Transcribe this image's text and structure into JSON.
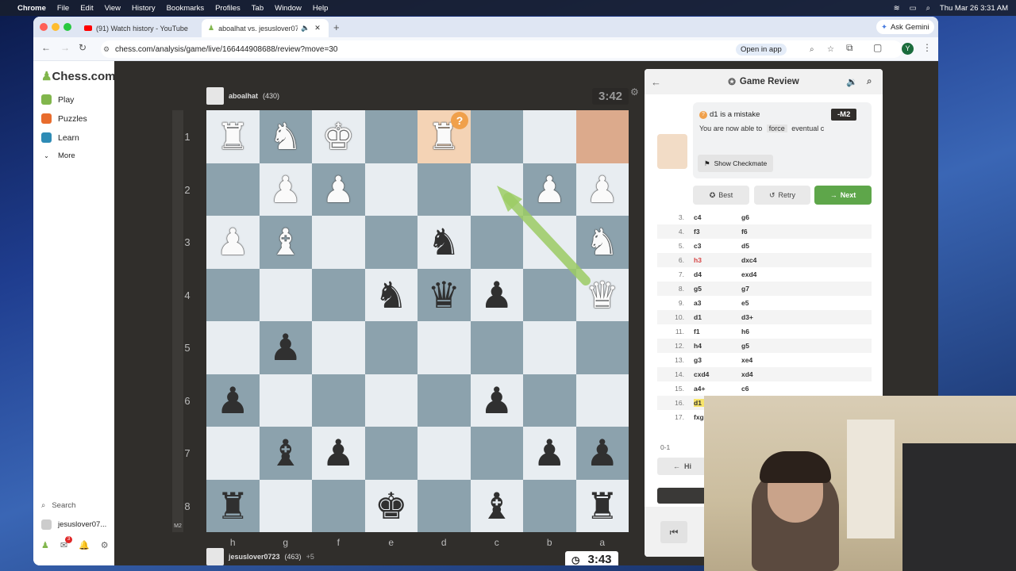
{
  "menubar": {
    "app": "Chrome",
    "items": [
      "File",
      "Edit",
      "View",
      "History",
      "Bookmarks",
      "Profiles",
      "Tab",
      "Window",
      "Help"
    ],
    "datetime": "Thu Mar 26  3:31 AM"
  },
  "tabs": [
    {
      "title": "(91) Watch history - YouTube"
    },
    {
      "title": "aboalhat vs. jesuslover07..."
    }
  ],
  "ask_gemini": "Ask Gemini",
  "url": "chess.com/analysis/game/live/166444908688/review?move=30",
  "open_in_app": "Open in app",
  "profile_initial": "Y",
  "sidenav": {
    "logo": "Chess.com",
    "items": [
      {
        "label": "Play",
        "icon": "play-pawn-icon"
      },
      {
        "label": "Puzzles",
        "icon": "puzzle-icon"
      },
      {
        "label": "Learn",
        "icon": "learn-cap-icon"
      },
      {
        "label": "More",
        "icon": "chevron-down-icon"
      }
    ],
    "search": "Search",
    "username": "jesuslover07...",
    "mail_count": "3"
  },
  "top_player": {
    "name": "aboalhat",
    "rating": "(430)",
    "clock": "3:42"
  },
  "bottom_player": {
    "name": "jesuslover0723",
    "rating": "(463)",
    "material": "+5",
    "clock": "3:43"
  },
  "eval_label": "M2",
  "board": {
    "ranks": [
      "1",
      "2",
      "3",
      "4",
      "5",
      "6",
      "7",
      "8"
    ],
    "files": [
      "h",
      "g",
      "f",
      "e",
      "d",
      "c",
      "b",
      "a"
    ],
    "pieces": [
      [
        "wR",
        "wN",
        "wK",
        "",
        "wR",
        "",
        "",
        ""
      ],
      [
        "",
        "wP",
        "wP",
        "",
        "",
        "",
        "wP",
        "wP"
      ],
      [
        "wP",
        "wB",
        "",
        "",
        "bN",
        "",
        "",
        "wN"
      ],
      [
        "",
        "",
        "",
        "bN",
        "bQ",
        "bP",
        "",
        "wQ"
      ],
      [
        "",
        "bP",
        "",
        "",
        "",
        "",
        "",
        ""
      ],
      [
        "bP",
        "",
        "",
        "",
        "",
        "bP",
        "",
        ""
      ],
      [
        "",
        "bB",
        "bP",
        "",
        "",
        "",
        "bP",
        "bP"
      ],
      [
        "bR",
        "",
        "",
        "bK",
        "",
        "bB",
        "",
        "bR"
      ]
    ]
  },
  "review": {
    "title": "Game Review",
    "mistake_text": "d1 is a mistake",
    "eval": "-M2",
    "coach_text": "You are now able to",
    "coach_word": "force",
    "coach_tail": "eventual c",
    "show_checkmate": "Show Checkmate",
    "best": "Best",
    "retry": "Retry",
    "next": "Next",
    "result": "0-1",
    "hint_partial": "Hi",
    "moves": [
      {
        "n": "3.",
        "w": "c4",
        "b": "g6"
      },
      {
        "n": "4.",
        "w": "f3",
        "b": "f6"
      },
      {
        "n": "5.",
        "w": "c3",
        "b": "d5"
      },
      {
        "n": "6.",
        "w": "h3",
        "b": "dxc4"
      },
      {
        "n": "7.",
        "w": "d4",
        "b": "exd4"
      },
      {
        "n": "8.",
        "w": "g5",
        "b": "g7"
      },
      {
        "n": "9.",
        "w": "a3",
        "b": "e5"
      },
      {
        "n": "10.",
        "w": "d1",
        "b": "d3+"
      },
      {
        "n": "11.",
        "w": "f1",
        "b": "h6"
      },
      {
        "n": "12.",
        "w": "h4",
        "b": "g5"
      },
      {
        "n": "13.",
        "w": "g3",
        "b": "xe4"
      },
      {
        "n": "14.",
        "w": "cxd4",
        "b": "xd4"
      },
      {
        "n": "15.",
        "w": "a4+",
        "b": "c6"
      },
      {
        "n": "16.",
        "w": "d1",
        "b": ""
      },
      {
        "n": "17.",
        "w": "fxg3",
        "b": ""
      }
    ]
  },
  "colors": {
    "light_square": "#e8edf1",
    "dark_square": "#8ca2ad",
    "highlight": "#f4d3b5",
    "next_button": "#5ea64a",
    "mistake": "#f0a04b",
    "blunder": "#d64343",
    "arrow": "#9ccc65"
  }
}
